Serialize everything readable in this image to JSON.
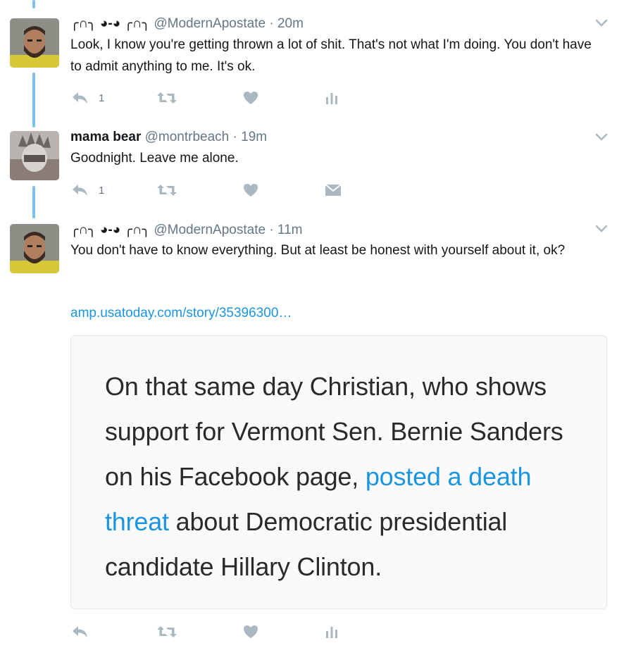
{
  "colors": {
    "accent": "#1b95e0",
    "thread": "#7ec0ee",
    "icon": "#aab8c2",
    "muted": "#657786"
  },
  "tweets": [
    {
      "name": "╭∩╮ ◕-◕ ╭∩╮",
      "handle": "@ModernApostate",
      "time": "· 20m",
      "text": "Look, I know you're getting thrown a lot of shit. That's not what I'm doing. You don't have to admit anything to me. It's ok.",
      "reply_count": "1",
      "extra_icon": "analytics-icon"
    },
    {
      "name": "mama bear",
      "handle": "@montrbeach",
      "time": "· 19m",
      "text": "Goodnight. Leave me alone.",
      "reply_count": "1",
      "extra_icon": "direct-message-icon"
    },
    {
      "name": "╭∩╮ ◕-◕ ╭∩╮",
      "handle": "@ModernApostate",
      "time": "· 11m",
      "text": "You don't have to know everything. But at least be honest with yourself about it, ok?",
      "link": "amp.usatoday.com/story/35396300…",
      "card": {
        "text_before": "On that same day Christian, who shows support for Vermont Sen. Bernie Sanders on his Facebook page, ",
        "link_text": "posted a death threat",
        "text_after": " about Democratic presidential candidate Hillary Clinton."
      },
      "reply_count": "",
      "extra_icon": "analytics-icon"
    }
  ]
}
